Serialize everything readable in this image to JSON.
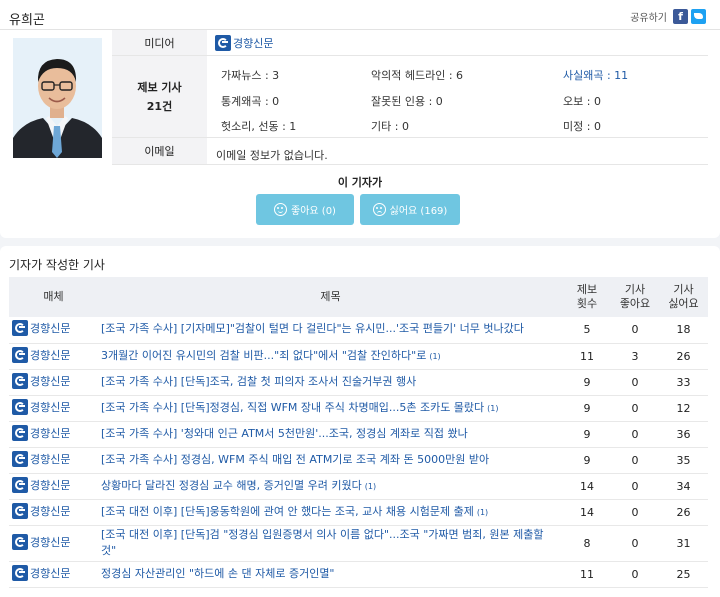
{
  "profile": {
    "name": "유희곤",
    "share_label": "공유하기",
    "fb_glyph": "f"
  },
  "info": {
    "media_label": "미디어",
    "media_name": "경향신문",
    "report_label": "제보 기사",
    "report_count": "21건",
    "stats": [
      {
        "label": "가짜뉴스 : 3"
      },
      {
        "label": "악의적 헤드라인 : 6"
      },
      {
        "label": "사실왜곡 : 11",
        "highlight": true
      },
      {
        "label": "통계왜곡 : 0"
      },
      {
        "label": "잘못된 인용 : 0"
      },
      {
        "label": "오보 : 0"
      },
      {
        "label": "헛소리, 선동 : 1"
      },
      {
        "label": "기타 : 0"
      },
      {
        "label": "미정 : 0"
      }
    ],
    "email_label": "이메일",
    "email_value": "이메일 정보가 없습니다."
  },
  "vote": {
    "title": "이 기자가",
    "like_label": "좋아요 (0)",
    "dislike_label": "싫어요 (169)"
  },
  "articles": {
    "section_title": "기자가 작성한 기사",
    "headers": {
      "media": "매체",
      "title": "제목",
      "reports_l1": "제보",
      "reports_l2": "횟수",
      "likes_l1": "기사",
      "likes_l2": "좋아요",
      "dislikes_l1": "기사",
      "dislikes_l2": "싫어요"
    },
    "rows": [
      {
        "media": "경향신문",
        "title": "[조국 가족 수사] [기자메모]\"검찰이 털면 다 걸린다\"는 유시민...'조국 편들기' 너무 벗나갔다",
        "count": "",
        "reports": "5",
        "likes": "0",
        "dislikes": "18"
      },
      {
        "media": "경향신문",
        "title": "3개월간 이어진 유시민의 검찰 비판...\"죄 없다\"에서 \"검찰 잔인하다\"로",
        "count": "(1)",
        "reports": "11",
        "likes": "3",
        "dislikes": "26"
      },
      {
        "media": "경향신문",
        "title": "[조국 가족 수사] [단독]조국, 검찰 첫 피의자 조사서 진술거부권 행사",
        "count": "",
        "reports": "9",
        "likes": "0",
        "dislikes": "33"
      },
      {
        "media": "경향신문",
        "title": "[조국 가족 수사] [단독]정경심, 직접 WFM 장내 주식 차명매입...5촌 조카도 몰랐다",
        "count": "(1)",
        "reports": "9",
        "likes": "0",
        "dislikes": "12"
      },
      {
        "media": "경향신문",
        "title": "[조국 가족 수사] '청와대 인근 ATM서 5천만원'...조국, 정경심 계좌로 직접 쐈나",
        "count": "",
        "reports": "9",
        "likes": "0",
        "dislikes": "36"
      },
      {
        "media": "경향신문",
        "title": "[조국 가족 수사] 정경심, WFM 주식 매입 전 ATM기로 조국 계좌 돈 5000만원 받아",
        "count": "",
        "reports": "9",
        "likes": "0",
        "dislikes": "35"
      },
      {
        "media": "경향신문",
        "title": "상황마다 달라진 정경심 교수 해명, 증거인멸 우려 키웠다",
        "count": "(1)",
        "reports": "14",
        "likes": "0",
        "dislikes": "34"
      },
      {
        "media": "경향신문",
        "title": "[조국 대전 이후] [단독]웅동학원에 관여 안 했다는 조국, 교사 채용 시험문제 출제",
        "count": "(1)",
        "reports": "14",
        "likes": "0",
        "dislikes": "26"
      },
      {
        "media": "경향신문",
        "title": "[조국 대전 이후] [단독]검 \"정경심 입원증명서 의사 이름 없다\"...조국 \"가짜면 범죄, 원본 제출할 것\"",
        "count": "",
        "reports": "8",
        "likes": "0",
        "dislikes": "31"
      },
      {
        "media": "경향신문",
        "title": "정경심 자산관리인 \"하드에 손 댄 자체로 증거인멸\"",
        "count": "",
        "reports": "11",
        "likes": "0",
        "dislikes": "25"
      }
    ]
  },
  "colors": {
    "accent": "#1f5aa6",
    "button": "#6fc6e1",
    "background": "#f2f4f7"
  }
}
